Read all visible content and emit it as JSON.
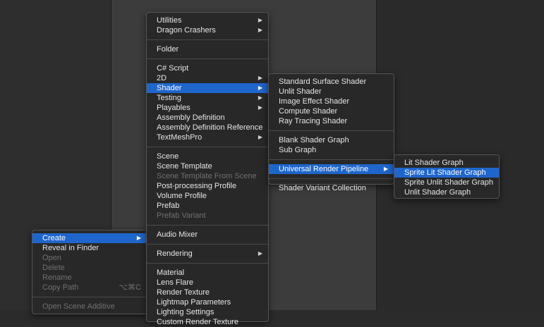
{
  "menu_main": {
    "group1": [
      "Utilities",
      "Dragon Crashers"
    ],
    "group2": [
      "Folder"
    ],
    "group3": [
      "C# Script",
      "2D",
      "Shader",
      "Testing",
      "Playables",
      "Assembly Definition",
      "Assembly Definition Reference",
      "TextMeshPro"
    ],
    "group4": [
      "Scene",
      "Scene Template",
      "Scene Template From Scene",
      "Post-processing Profile",
      "Volume Profile",
      "Prefab",
      "Prefab Variant"
    ],
    "group5": [
      "Audio Mixer"
    ],
    "group6": [
      "Rendering"
    ],
    "group7": [
      "Material",
      "Lens Flare",
      "Render Texture",
      "Lightmap Parameters",
      "Lighting Settings",
      "Custom Render Texture"
    ]
  },
  "menu_shader": {
    "group1": [
      "Standard Surface Shader",
      "Unlit Shader",
      "Image Effect Shader",
      "Compute Shader",
      "Ray Tracing Shader"
    ],
    "group2": [
      "Blank Shader Graph",
      "Sub Graph"
    ],
    "group3": [
      "Universal Render Pipeline"
    ],
    "group4": [
      "Shader Variant Collection"
    ]
  },
  "menu_urp": {
    "items": [
      "Lit Shader Graph",
      "Sprite Lit Shader Graph",
      "Sprite Unlit Shader Graph",
      "Unlit Shader Graph"
    ]
  },
  "menu_context": {
    "items": [
      "Create",
      "Reveal in Finder",
      "Open",
      "Delete",
      "Rename",
      "Copy Path",
      "Open Scene Additive"
    ],
    "copy_path_shortcut": "⌥⌘C"
  },
  "icons": {
    "submenu_arrow": "▶"
  },
  "colors": {
    "selection": "#1f66cc",
    "menu_bg": "#282828",
    "disabled_text": "#707070"
  }
}
